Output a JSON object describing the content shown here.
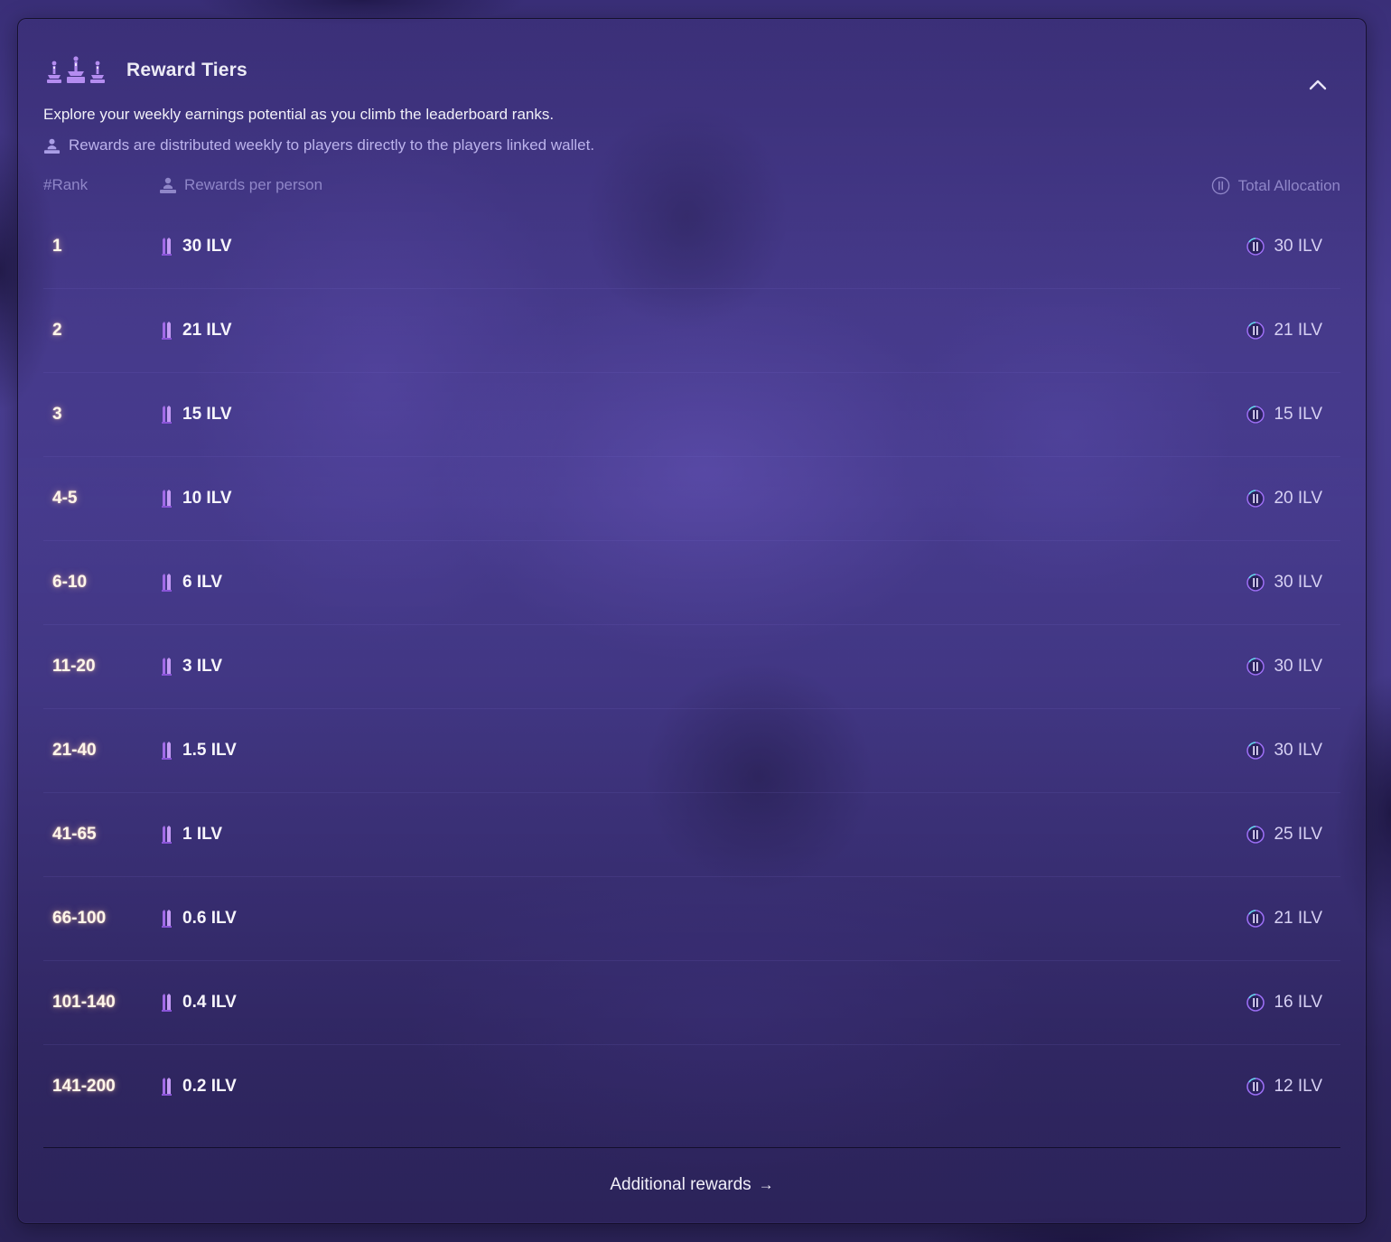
{
  "header": {
    "title": "Reward Tiers",
    "subtitle": "Explore your weekly earnings potential as you climb the leaderboard ranks.",
    "note": "Rewards are distributed weekly to players directly to the players linked wallet.",
    "collapse_icon": "chevron-up-icon"
  },
  "columns": {
    "rank": "#Rank",
    "reward": "Rewards per person",
    "total": "Total Allocation"
  },
  "tiers": [
    {
      "rank": "1",
      "reward": "30 ILV",
      "total": "30 ILV"
    },
    {
      "rank": "2",
      "reward": "21 ILV",
      "total": "21 ILV"
    },
    {
      "rank": "3",
      "reward": "15 ILV",
      "total": "15 ILV"
    },
    {
      "rank": "4-5",
      "reward": "10 ILV",
      "total": "20 ILV"
    },
    {
      "rank": "6-10",
      "reward": "6 ILV",
      "total": "30 ILV"
    },
    {
      "rank": "11-20",
      "reward": "3 ILV",
      "total": "30 ILV"
    },
    {
      "rank": "21-40",
      "reward": "1.5 ILV",
      "total": "30 ILV"
    },
    {
      "rank": "41-65",
      "reward": "1 ILV",
      "total": "25 ILV"
    },
    {
      "rank": "66-100",
      "reward": "0.6 ILV",
      "total": "21 ILV"
    },
    {
      "rank": "101-140",
      "reward": "0.4 ILV",
      "total": "16 ILV"
    },
    {
      "rank": "141-200",
      "reward": "0.2 ILV",
      "total": "12 ILV"
    }
  ],
  "footer": {
    "additional_rewards": "Additional rewards",
    "arrow": "→"
  },
  "colors": {
    "accent_purple": "#a678f0",
    "rank_glow": "#ffc8a0",
    "note_text": "#bcb3ec",
    "header_text": "#8f86c8"
  }
}
